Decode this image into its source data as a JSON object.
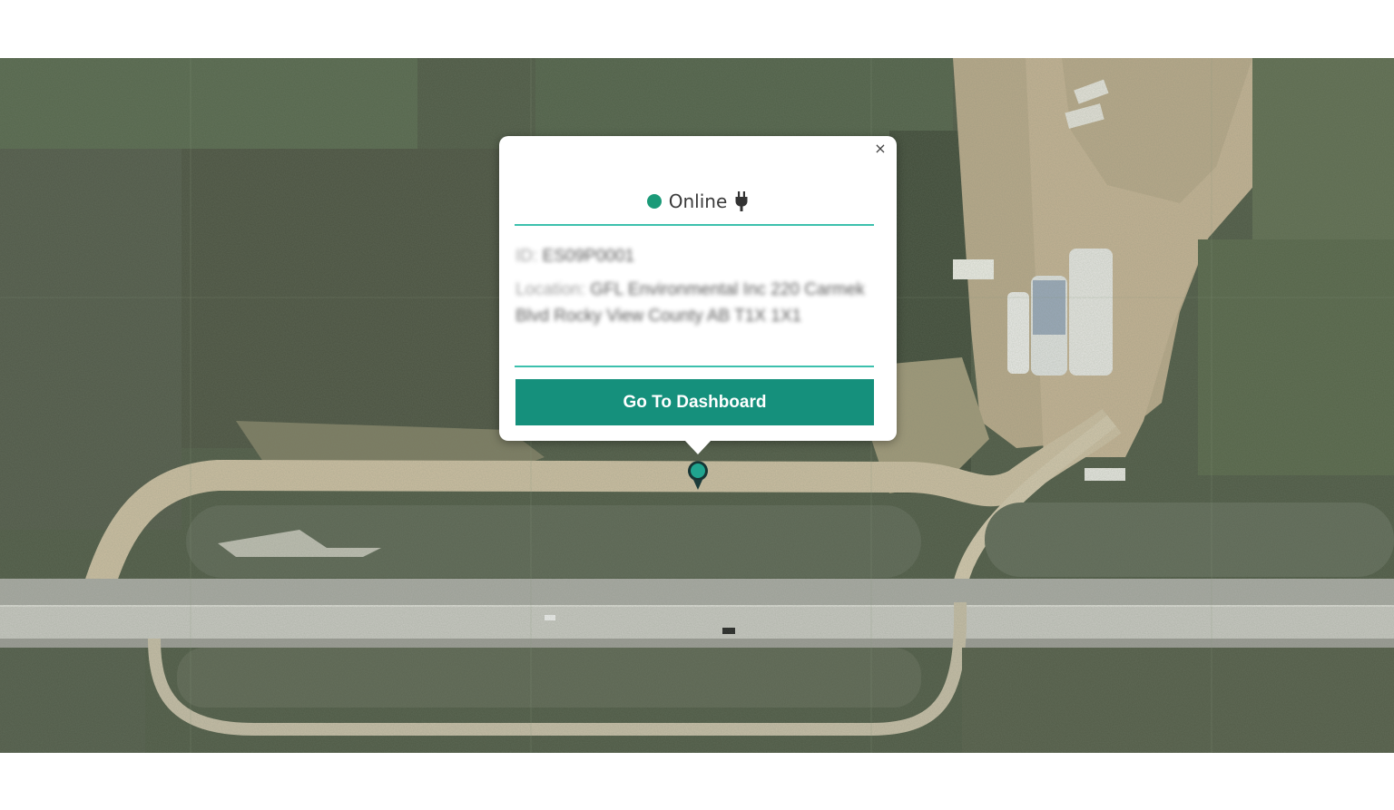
{
  "map": {
    "type": "satellite",
    "marker_icon": "map-pin-icon",
    "marker_color": "#20a58f"
  },
  "popup": {
    "close_label": "×",
    "status": {
      "text": "Online",
      "dot_color": "#1b9a78",
      "icon": "plug-icon"
    },
    "details": {
      "id_label": "ID:",
      "id_value": "ES09P0001",
      "location_label": "Location:",
      "location_value": "GFL Environmental Inc 220 Carmek Blvd Rocky View County AB T1X 1X1",
      "blurred": true
    },
    "button_label": "Go To Dashboard",
    "accent_color": "#15907c",
    "divider_color": "#3cc0ad"
  }
}
